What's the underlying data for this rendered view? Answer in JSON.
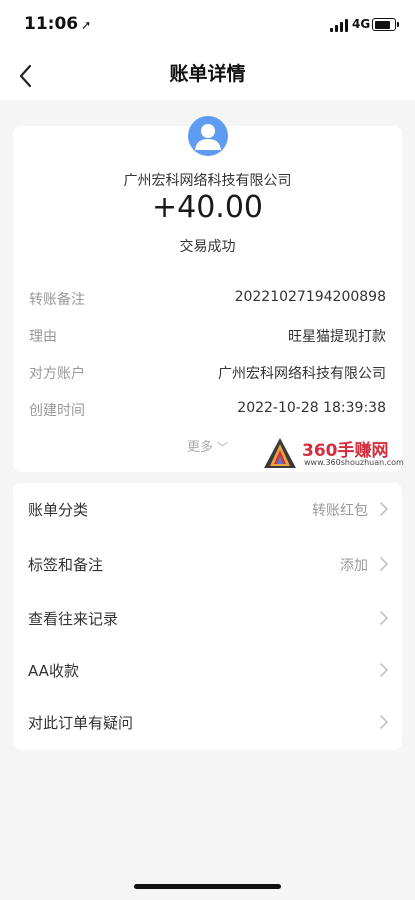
{
  "status_bar": {
    "time": "11:06",
    "network": "4G",
    "icons": [
      "location-arrow-icon",
      "signal-icon",
      "battery-icon"
    ]
  },
  "nav": {
    "title": "账单详情",
    "back_icon": "chevron-left-icon"
  },
  "summary": {
    "avatar_icon": "user-avatar-icon",
    "payee": "广州宏科网络科技有限公司",
    "amount": "+40.00",
    "status": "交易成功"
  },
  "details": [
    {
      "label": "转账备注",
      "value": "20221027194200898"
    },
    {
      "label": "理由",
      "value": "旺星猫提现打款"
    },
    {
      "label": "对方账户",
      "value": "广州宏科网络科技有限公司"
    },
    {
      "label": "创建时间",
      "value": "2022-10-28 18:39:38"
    }
  ],
  "more": {
    "label": "更多",
    "icon": "chevron-down-icon"
  },
  "watermark": {
    "title": "360手赚网",
    "url": "www.360shouzhuan.com"
  },
  "actions": [
    {
      "label": "账单分类",
      "value": "转账红包"
    },
    {
      "label": "标签和备注",
      "value": "添加"
    },
    {
      "label": "查看往来记录",
      "value": ""
    },
    {
      "label": "AA收款",
      "value": ""
    },
    {
      "label": "对此订单有疑问",
      "value": ""
    }
  ],
  "colors": {
    "background": "#f5f5f5",
    "card": "#ffffff",
    "avatar": "#5d9cf0",
    "label_gray": "#999999",
    "text": "#333333",
    "watermark_red": "#d42d3d"
  }
}
